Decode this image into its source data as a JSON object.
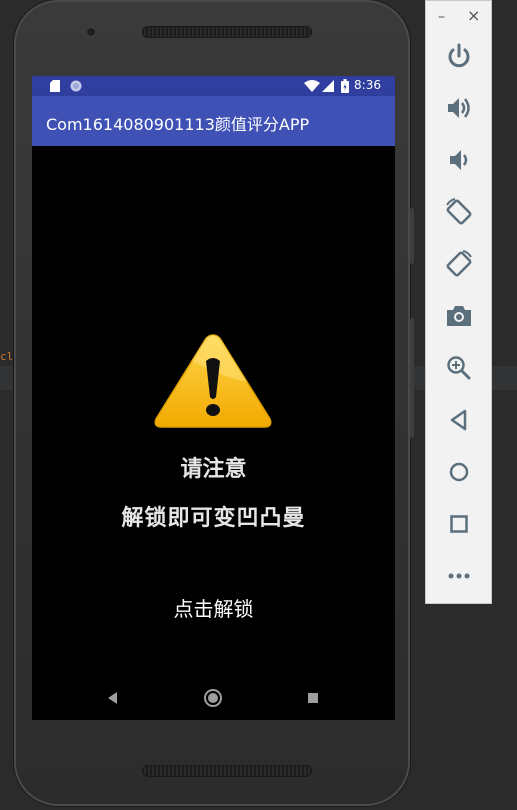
{
  "ide": {
    "code_snippet": "cla"
  },
  "status_bar": {
    "time": "8:36"
  },
  "app_bar": {
    "title": "Com1614080901113颜值评分APP"
  },
  "content": {
    "notice_title": "请注意",
    "notice_text": "解锁即可变凹凸曼",
    "unlock_button": "点击解锁"
  },
  "toolbar": {
    "minimize": "–",
    "close": "×",
    "buttons": [
      "power-icon",
      "volume-up-icon",
      "volume-down-icon",
      "rotate-left-icon",
      "rotate-right-icon",
      "screenshot-icon",
      "zoom-icon",
      "back-icon",
      "home-icon",
      "overview-icon",
      "more-icon"
    ]
  },
  "colors": {
    "status_bar": "#303f9f",
    "app_bar": "#3f51b5",
    "toolbar_icon": "#5b6f7d",
    "warning_yellow": "#f5b800"
  }
}
